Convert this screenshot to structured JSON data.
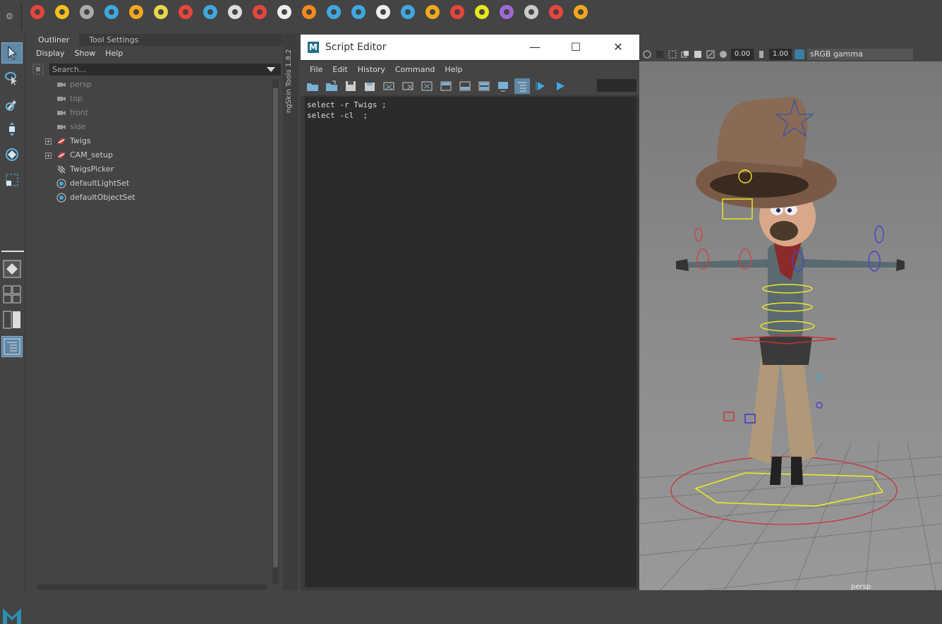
{
  "shelf": {
    "icons": [
      "layers-icon",
      "rotate-r-icon",
      "maya-m-icon",
      "share-nodes-icon",
      "fire-icon",
      "stack-lines-icon",
      "magnet-icon",
      "butterfly-icon",
      "crossed-lines-icon",
      "grid-dots-icon",
      "brush-circle-icon",
      "share-icon",
      "sparkle-icon",
      "tag-icon",
      "sun-icon",
      "diamond-icon",
      "lock-icon",
      "hook-icon",
      "path-icon",
      "compass-icon",
      "print-icon",
      "compass-circle-icon",
      "color-wheel-icon"
    ]
  },
  "outliner": {
    "tabs": [
      "Outliner",
      "Tool Settings"
    ],
    "menu": [
      "Display",
      "Show",
      "Help"
    ],
    "search_placeholder": "Search...",
    "items": [
      {
        "label": "persp",
        "icon": "camera-icon",
        "dim": true,
        "expand": false
      },
      {
        "label": "top",
        "icon": "camera-icon",
        "dim": true,
        "expand": false
      },
      {
        "label": "front",
        "icon": "camera-icon",
        "dim": true,
        "expand": false
      },
      {
        "label": "side",
        "icon": "camera-icon",
        "dim": true,
        "expand": false
      },
      {
        "label": "Twigs",
        "icon": "transform-icon",
        "dim": false,
        "expand": true
      },
      {
        "label": "CAM_setup",
        "icon": "transform-icon",
        "dim": false,
        "expand": true
      },
      {
        "label": "TwigsPicker",
        "icon": "picker-icon",
        "dim": false,
        "expand": false
      },
      {
        "label": "defaultLightSet",
        "icon": "set-icon",
        "dim": false,
        "expand": false
      },
      {
        "label": "defaultObjectSet",
        "icon": "set-icon",
        "dim": false,
        "expand": false
      }
    ]
  },
  "ngskin": {
    "label": "ngSkin Tools 1.8.2"
  },
  "script_editor": {
    "title": "Script Editor",
    "menu": [
      "File",
      "Edit",
      "History",
      "Command",
      "Help"
    ],
    "code": "select -r Twigs ;\nselect -cl  ;"
  },
  "viewport": {
    "exposure": "0.00",
    "gamma": "1.00",
    "colorspace": "sRGB gamma",
    "camera": "persp"
  },
  "colors": {
    "accent": "#5f87a6",
    "bg": "#444444",
    "field": "#2b2b2b"
  }
}
